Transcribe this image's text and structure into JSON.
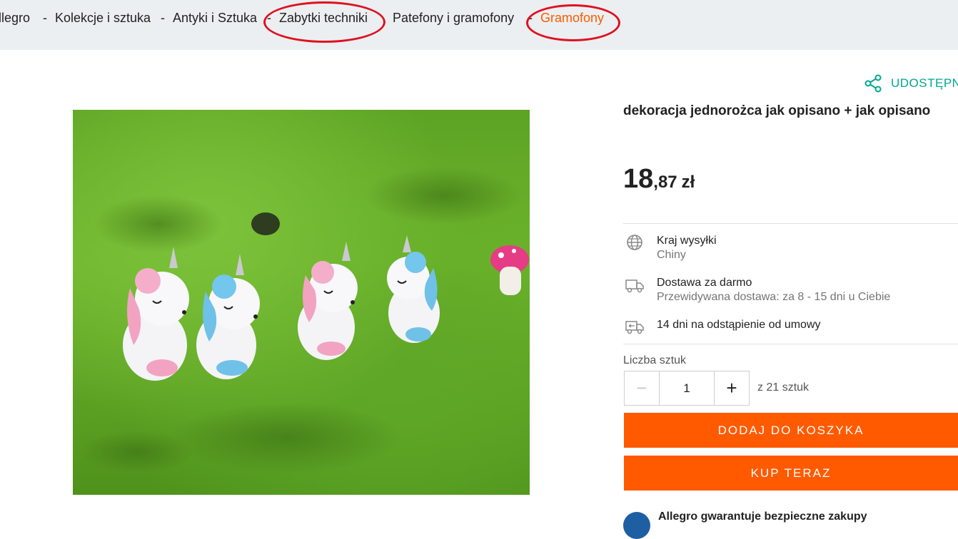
{
  "breadcrumb": {
    "items": [
      {
        "label": "llegro"
      },
      {
        "label": "Kolekcje i sztuka"
      },
      {
        "label": "Antyki i Sztuka"
      },
      {
        "label": "Zabytki techniki"
      },
      {
        "label": "Patefony i gramofony"
      },
      {
        "label": "Gramofony"
      }
    ],
    "separator": "-"
  },
  "share": {
    "label": "UDOSTĘPN",
    "icon": "share-icon"
  },
  "product": {
    "title": "dekoracja jednorożca jak opisano + jak opisano",
    "price": {
      "integer": "18",
      "decimal": ",87",
      "currency": "zł"
    }
  },
  "shipping": {
    "country_label": "Kraj wysyłki",
    "country_value": "Chiny",
    "delivery_label": "Dostawa za darmo",
    "delivery_estimate": "Przewidywana dostawa: za 8 - 15 dni u Ciebie",
    "returns_label": "14 dni na odstąpienie od umowy"
  },
  "quantity": {
    "label": "Liczba sztuk",
    "value": "1",
    "stock": "z 21 sztuk"
  },
  "buttons": {
    "add_to_cart": "DODAJ DO KOSZYKA",
    "buy_now": "KUP TERAZ"
  },
  "guarantee": {
    "text": "Allegro gwarantuje bezpieczne zakupy"
  },
  "colors": {
    "accent": "#ff5a00",
    "share": "#00a790",
    "annotation": "#e01020"
  }
}
